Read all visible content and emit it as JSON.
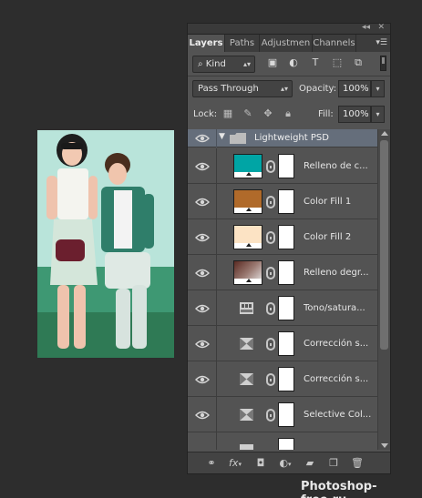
{
  "panel": {
    "tabs": [
      {
        "label": "Layers",
        "active": true
      },
      {
        "label": "Paths",
        "active": false
      },
      {
        "label": "Adjustmen",
        "active": false
      },
      {
        "label": "Channels",
        "active": false
      }
    ],
    "menu_icon": "panel-menu-icon"
  },
  "filter": {
    "kind_label": "Kind",
    "icons": [
      "image-filter-icon",
      "adjustment-filter-icon",
      "type-filter-icon",
      "shape-filter-icon",
      "smart-object-filter-icon"
    ]
  },
  "blend": {
    "mode": "Pass Through",
    "opacity_label": "Opacity:",
    "opacity_value": "100%"
  },
  "lock": {
    "label": "Lock:",
    "fill_label": "Fill:",
    "fill_value": "100%"
  },
  "group": {
    "name": "Lightweight PSD",
    "expanded": true
  },
  "layers": [
    {
      "name": "Relleno de c...",
      "thumb": "fill",
      "color": "#00a5a5"
    },
    {
      "name": "Color Fill 1",
      "thumb": "fill",
      "color": "#b06a2a"
    },
    {
      "name": "Color Fill 2",
      "thumb": "fill",
      "color": "#fce3c4"
    },
    {
      "name": "Relleno degr...",
      "thumb": "gradient",
      "color": "#5a2a22"
    },
    {
      "name": "Tono/satura...",
      "thumb": "adjustment",
      "icon": "hue-saturation-icon"
    },
    {
      "name": "Corrección s...",
      "thumb": "adjustment",
      "icon": "selective-color-icon"
    },
    {
      "name": "Corrección s...",
      "thumb": "adjustment",
      "icon": "selective-color-icon"
    },
    {
      "name": "Selective Col...",
      "thumb": "adjustment",
      "icon": "selective-color-icon"
    }
  ],
  "bottom_icons": [
    "link-layers-icon",
    "fx-icon",
    "add-mask-icon",
    "adjustment-layer-icon",
    "new-group-icon",
    "new-layer-icon",
    "trash-icon"
  ],
  "watermark": "Photoshop-free.ru"
}
